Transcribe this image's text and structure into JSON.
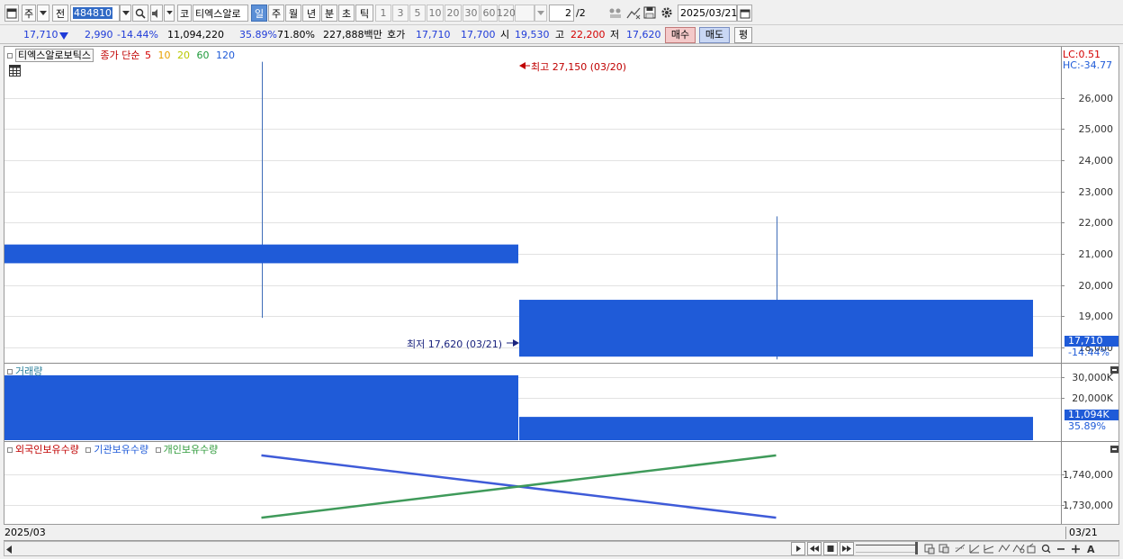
{
  "toolbar": {
    "period_button": "주",
    "prev_label": "전",
    "code_value": "484810",
    "code_label": "코",
    "stock_name": "티엑스알로",
    "periods": [
      "일",
      "주",
      "월",
      "년",
      "분",
      "초",
      "틱"
    ],
    "active_period": "일",
    "intervals": [
      "1",
      "3",
      "5",
      "10",
      "20",
      "30",
      "60",
      "120"
    ],
    "page_counter": "2",
    "page_total": "/2",
    "date_value": "2025/03/21"
  },
  "quote": {
    "price": "17,710",
    "change": "2,990",
    "change_pct": "-14.44%",
    "volume": "11,094,220",
    "ratio1": "35.89%",
    "ratio2": "71.80%",
    "amount": "227,888백만",
    "bid_label": "호가",
    "bid1": "17,710",
    "bid2": "17,700",
    "open_label": "시",
    "open": "19,530",
    "high_label": "고",
    "high": "22,200",
    "low_label": "저",
    "low": "17,620",
    "buy_label": "매수",
    "sell_label": "매도",
    "eval_label": "평"
  },
  "price_panel": {
    "legend_name": "티엑스알로보틱스",
    "legend_ma_label": "종가 단순",
    "ma_periods": [
      "5",
      "10",
      "20",
      "60",
      "120"
    ],
    "ma_colors": [
      "#d40000",
      "#e8a000",
      "#b8c800",
      "#1e9a3a",
      "#1f5bd8"
    ],
    "lc_label": "LC:0.51",
    "hc_label": "HC:-34.77",
    "high_annotation": "최고 27,150 (03/20)",
    "low_annotation": "최저 17,620 (03/21)",
    "y_ticks": [
      "26,000",
      "25,000",
      "24,000",
      "23,000",
      "22,000",
      "21,000",
      "20,000",
      "19,000",
      "18,000"
    ],
    "last_price_tag": "17,710",
    "last_change_tag": "-14.44%"
  },
  "volume_panel": {
    "legend_name": "거래량",
    "y_ticks": [
      "30,000K",
      "20,000K"
    ],
    "last_volume_tag": "11,094K",
    "last_ratio_tag": "35.89%"
  },
  "holding_panel": {
    "legend_items": [
      {
        "label": "외국인보유수량",
        "color": "#c00000"
      },
      {
        "label": "기관보유수량",
        "color": "#1f5bd8"
      },
      {
        "label": "개인보유수량",
        "color": "#2e9a3a"
      }
    ],
    "y_ticks": [
      "1,740,000",
      "1,730,000"
    ]
  },
  "x_axis": {
    "start_label": "2025/03",
    "end_label": "03/21"
  },
  "chart_data": [
    {
      "type": "candlestick",
      "title": "티엑스알로보틱스",
      "categories": [
        "03/20",
        "03/21"
      ],
      "ohlc": [
        {
          "date": "03/20",
          "open": 21300,
          "high": 27150,
          "low": 18950,
          "close": 20700
        },
        {
          "date": "03/21",
          "open": 19530,
          "high": 22200,
          "low": 17620,
          "close": 17710
        }
      ],
      "ylim": [
        17600,
        27400
      ],
      "color": "#1f5bd8"
    },
    {
      "type": "bar",
      "title": "거래량",
      "categories": [
        "03/20",
        "03/21"
      ],
      "values": [
        30900,
        11094
      ],
      "unit": "K",
      "ylim": [
        0,
        33000
      ],
      "color": "#1f5bd8"
    },
    {
      "type": "line",
      "categories": [
        "03/20",
        "03/21"
      ],
      "series": [
        {
          "name": "기관보유수량",
          "values": [
            1746000,
            1726000
          ],
          "color": "#3f5bd8"
        },
        {
          "name": "개인보유수량",
          "values": [
            1726000,
            1746000
          ],
          "color": "#3f9a5a"
        }
      ],
      "ylim": [
        1724000,
        1748000
      ]
    }
  ]
}
